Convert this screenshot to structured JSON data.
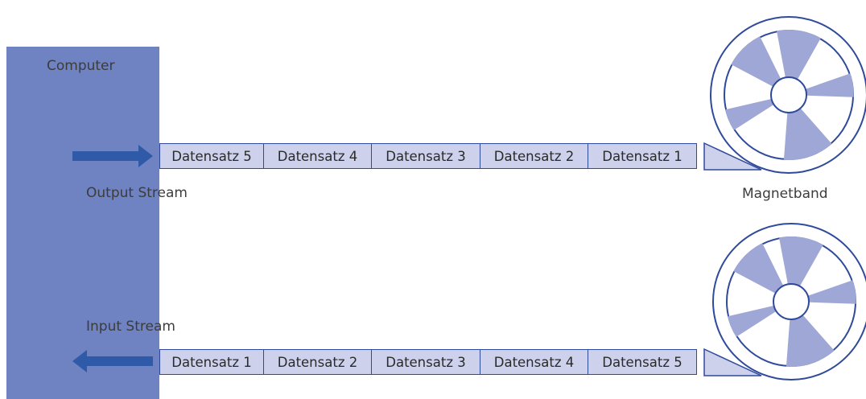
{
  "labels": {
    "computer": "Computer",
    "output_stream": "Output Stream",
    "input_stream": "Input Stream",
    "magnetband": "Magnetband"
  },
  "output_records": [
    "Datensatz 5",
    "Datensatz 4",
    "Datensatz 3",
    "Datensatz 2",
    "Datensatz 1"
  ],
  "input_records": [
    "Datensatz 1",
    "Datensatz 2",
    "Datensatz 3",
    "Datensatz 4",
    "Datensatz 5"
  ],
  "colors": {
    "computer": "#6f82c2",
    "record_fill": "#cdd1ec",
    "record_border": "#2f4a9a",
    "arrow": "#2f5aa8",
    "reel_blade": "#9ea7d5",
    "reel_outline": "#2f4a9a"
  }
}
